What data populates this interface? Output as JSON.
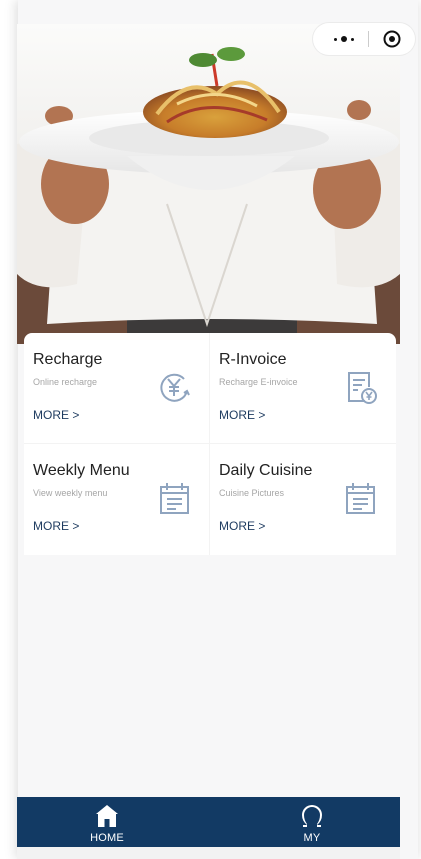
{
  "capsule": {
    "more_icon": "more-dots-icon",
    "close_icon": "target-icon"
  },
  "hero": {
    "image": "chef-holding-pasta-dish-photo"
  },
  "cards": [
    {
      "title": "Recharge",
      "subtitle": "Online recharge",
      "more": "MORE >",
      "icon": "yuan-recharge-icon"
    },
    {
      "title": "R-Invoice",
      "subtitle": "Recharge E-invoice",
      "more": "MORE >",
      "icon": "invoice-yuan-icon"
    },
    {
      "title": "Weekly Menu",
      "subtitle": "View weekly menu",
      "more": "MORE >",
      "icon": "calendar-icon"
    },
    {
      "title": "Daily Cuisine",
      "subtitle": "Cuisine Pictures",
      "more": "MORE >",
      "icon": "calendar-icon"
    }
  ],
  "tabbar": {
    "home_label": "HOME",
    "my_label": "MY"
  },
  "colors": {
    "tabbar_bg": "#123a64",
    "more_link": "#1d3a5f",
    "icon_stroke": "#8fa4bf"
  }
}
